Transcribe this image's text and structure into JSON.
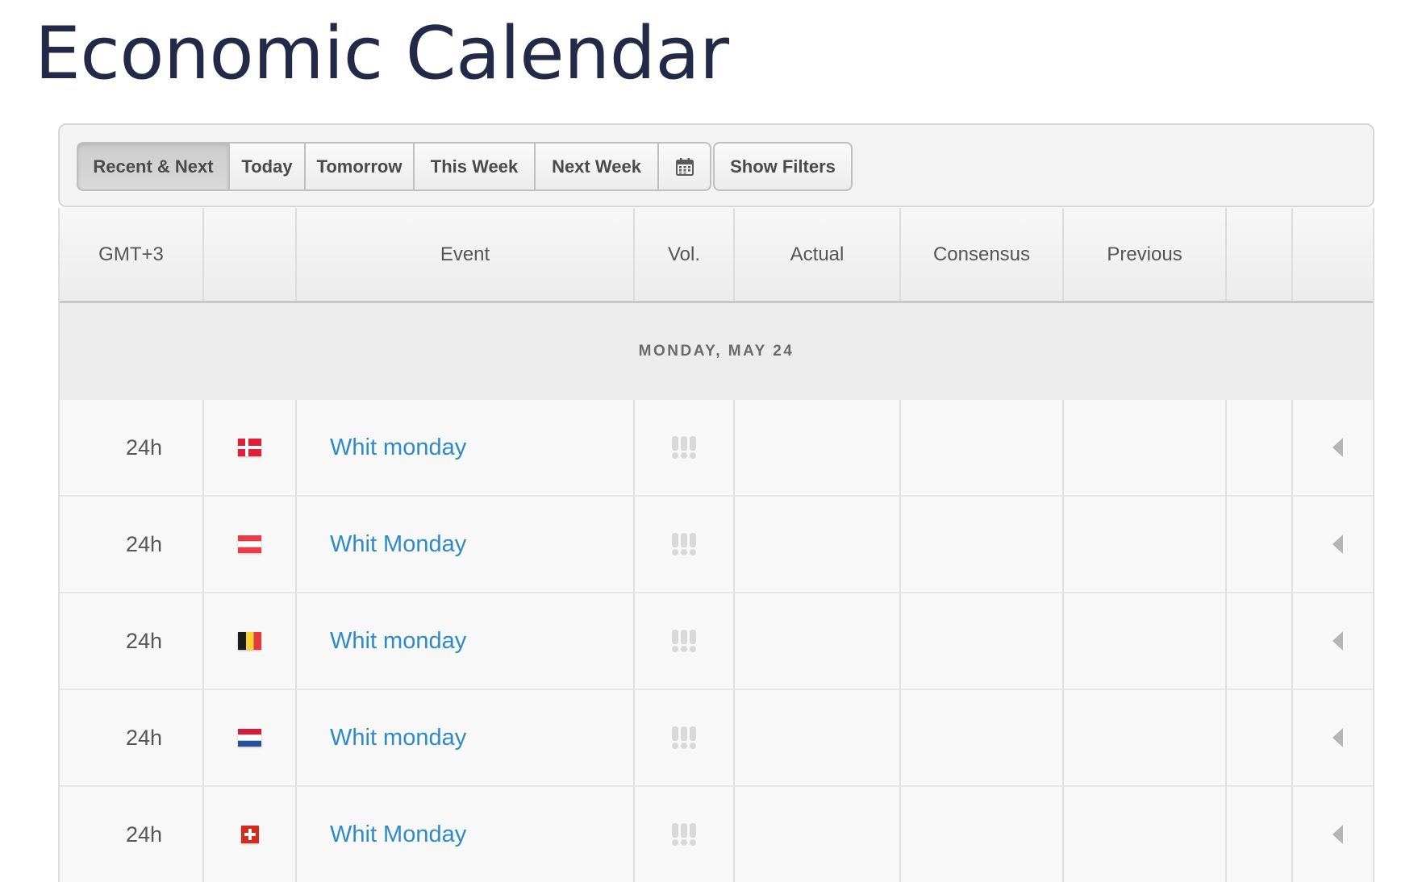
{
  "page": {
    "title": "Economic Calendar"
  },
  "toolbar": {
    "buttons": [
      {
        "label": "Recent & Next",
        "active": true
      },
      {
        "label": "Today",
        "active": false
      },
      {
        "label": "Tomorrow",
        "active": false
      },
      {
        "label": "This Week",
        "active": false
      },
      {
        "label": "Next Week",
        "active": false
      }
    ],
    "calendar_icon": "calendar-icon",
    "filters_label": "Show Filters"
  },
  "table": {
    "columns": {
      "time": "GMT+3",
      "flag": "",
      "event": "Event",
      "vol": "Vol.",
      "actual": "Actual",
      "consensus": "Consensus",
      "previous": "Previous",
      "extra": "",
      "expand": ""
    },
    "date_header": "MONDAY, MAY 24",
    "rows": [
      {
        "time": "24h",
        "flag": "denmark-flag",
        "event": "Whit monday",
        "volatility_icon": "volatility-icon",
        "actual": "",
        "consensus": "",
        "previous": ""
      },
      {
        "time": "24h",
        "flag": "austria-flag",
        "event": "Whit Monday",
        "volatility_icon": "volatility-icon",
        "actual": "",
        "consensus": "",
        "previous": ""
      },
      {
        "time": "24h",
        "flag": "belgium-flag",
        "event": "Whit monday",
        "volatility_icon": "volatility-icon",
        "actual": "",
        "consensus": "",
        "previous": ""
      },
      {
        "time": "24h",
        "flag": "netherlands-flag",
        "event": "Whit monday",
        "volatility_icon": "volatility-icon",
        "actual": "",
        "consensus": "",
        "previous": ""
      },
      {
        "time": "24h",
        "flag": "switzerland-flag",
        "event": "Whit Monday",
        "volatility_icon": "volatility-icon",
        "actual": "",
        "consensus": "",
        "previous": ""
      }
    ]
  },
  "colors": {
    "title": "#222a48",
    "link": "#2e8bc9",
    "active_button": "#cdcdcd"
  }
}
